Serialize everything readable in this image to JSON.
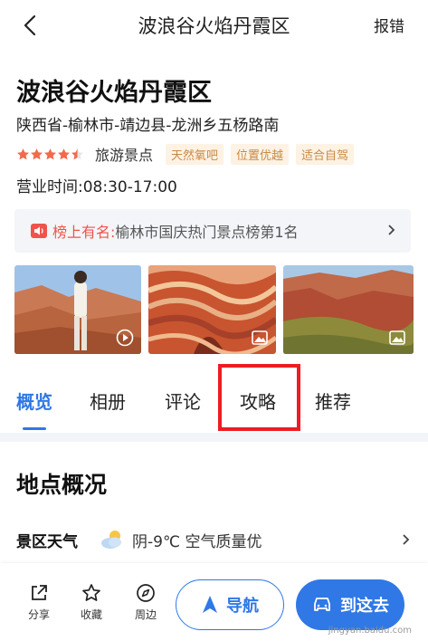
{
  "topbar": {
    "title": "波浪谷火焰丹霞区",
    "report_label": "报错"
  },
  "poi": {
    "name": "波浪谷火焰丹霞区",
    "address": "陕西省-榆林市-靖边县-龙洲乡五杨路南",
    "rating": 4.5,
    "category": "旅游景点",
    "tags": [
      "天然氧吧",
      "位置优越",
      "适合自驾"
    ],
    "hours": "营业时间:08:30-17:00"
  },
  "rank": {
    "prefix": "榜上有名:",
    "text": "榆林市国庆热门景点榜第1名"
  },
  "photos": [
    {
      "kind": "video",
      "icon": "play-icon"
    },
    {
      "kind": "image",
      "icon": "image-icon"
    },
    {
      "kind": "image",
      "icon": "image-icon"
    }
  ],
  "tabs": [
    {
      "label": "概览",
      "active": true
    },
    {
      "label": "相册",
      "active": false
    },
    {
      "label": "评论",
      "active": false
    },
    {
      "label": "攻略",
      "active": false,
      "highlighted": true
    },
    {
      "label": "推荐",
      "active": false
    }
  ],
  "overview": {
    "title": "地点概况",
    "weather_label": "景区天气",
    "weather_text": "阴-9℃ 空气质量优",
    "weather_icon": "cloud-sun-icon"
  },
  "bottombar": {
    "actions": [
      {
        "label": "分享",
        "icon": "share-icon"
      },
      {
        "label": "收藏",
        "icon": "star-icon"
      },
      {
        "label": "周边",
        "icon": "compass-icon"
      }
    ],
    "nav_label": "导航",
    "go_label": "到这去"
  },
  "watermark": "jingyan.baidu.com",
  "colors": {
    "accent": "#2f78e6",
    "rank_red": "#f0534a",
    "tag_text": "#c98a45",
    "tag_bg": "#fdf2e3",
    "highlight": "#ee1c24",
    "star": "#f06a4b"
  }
}
